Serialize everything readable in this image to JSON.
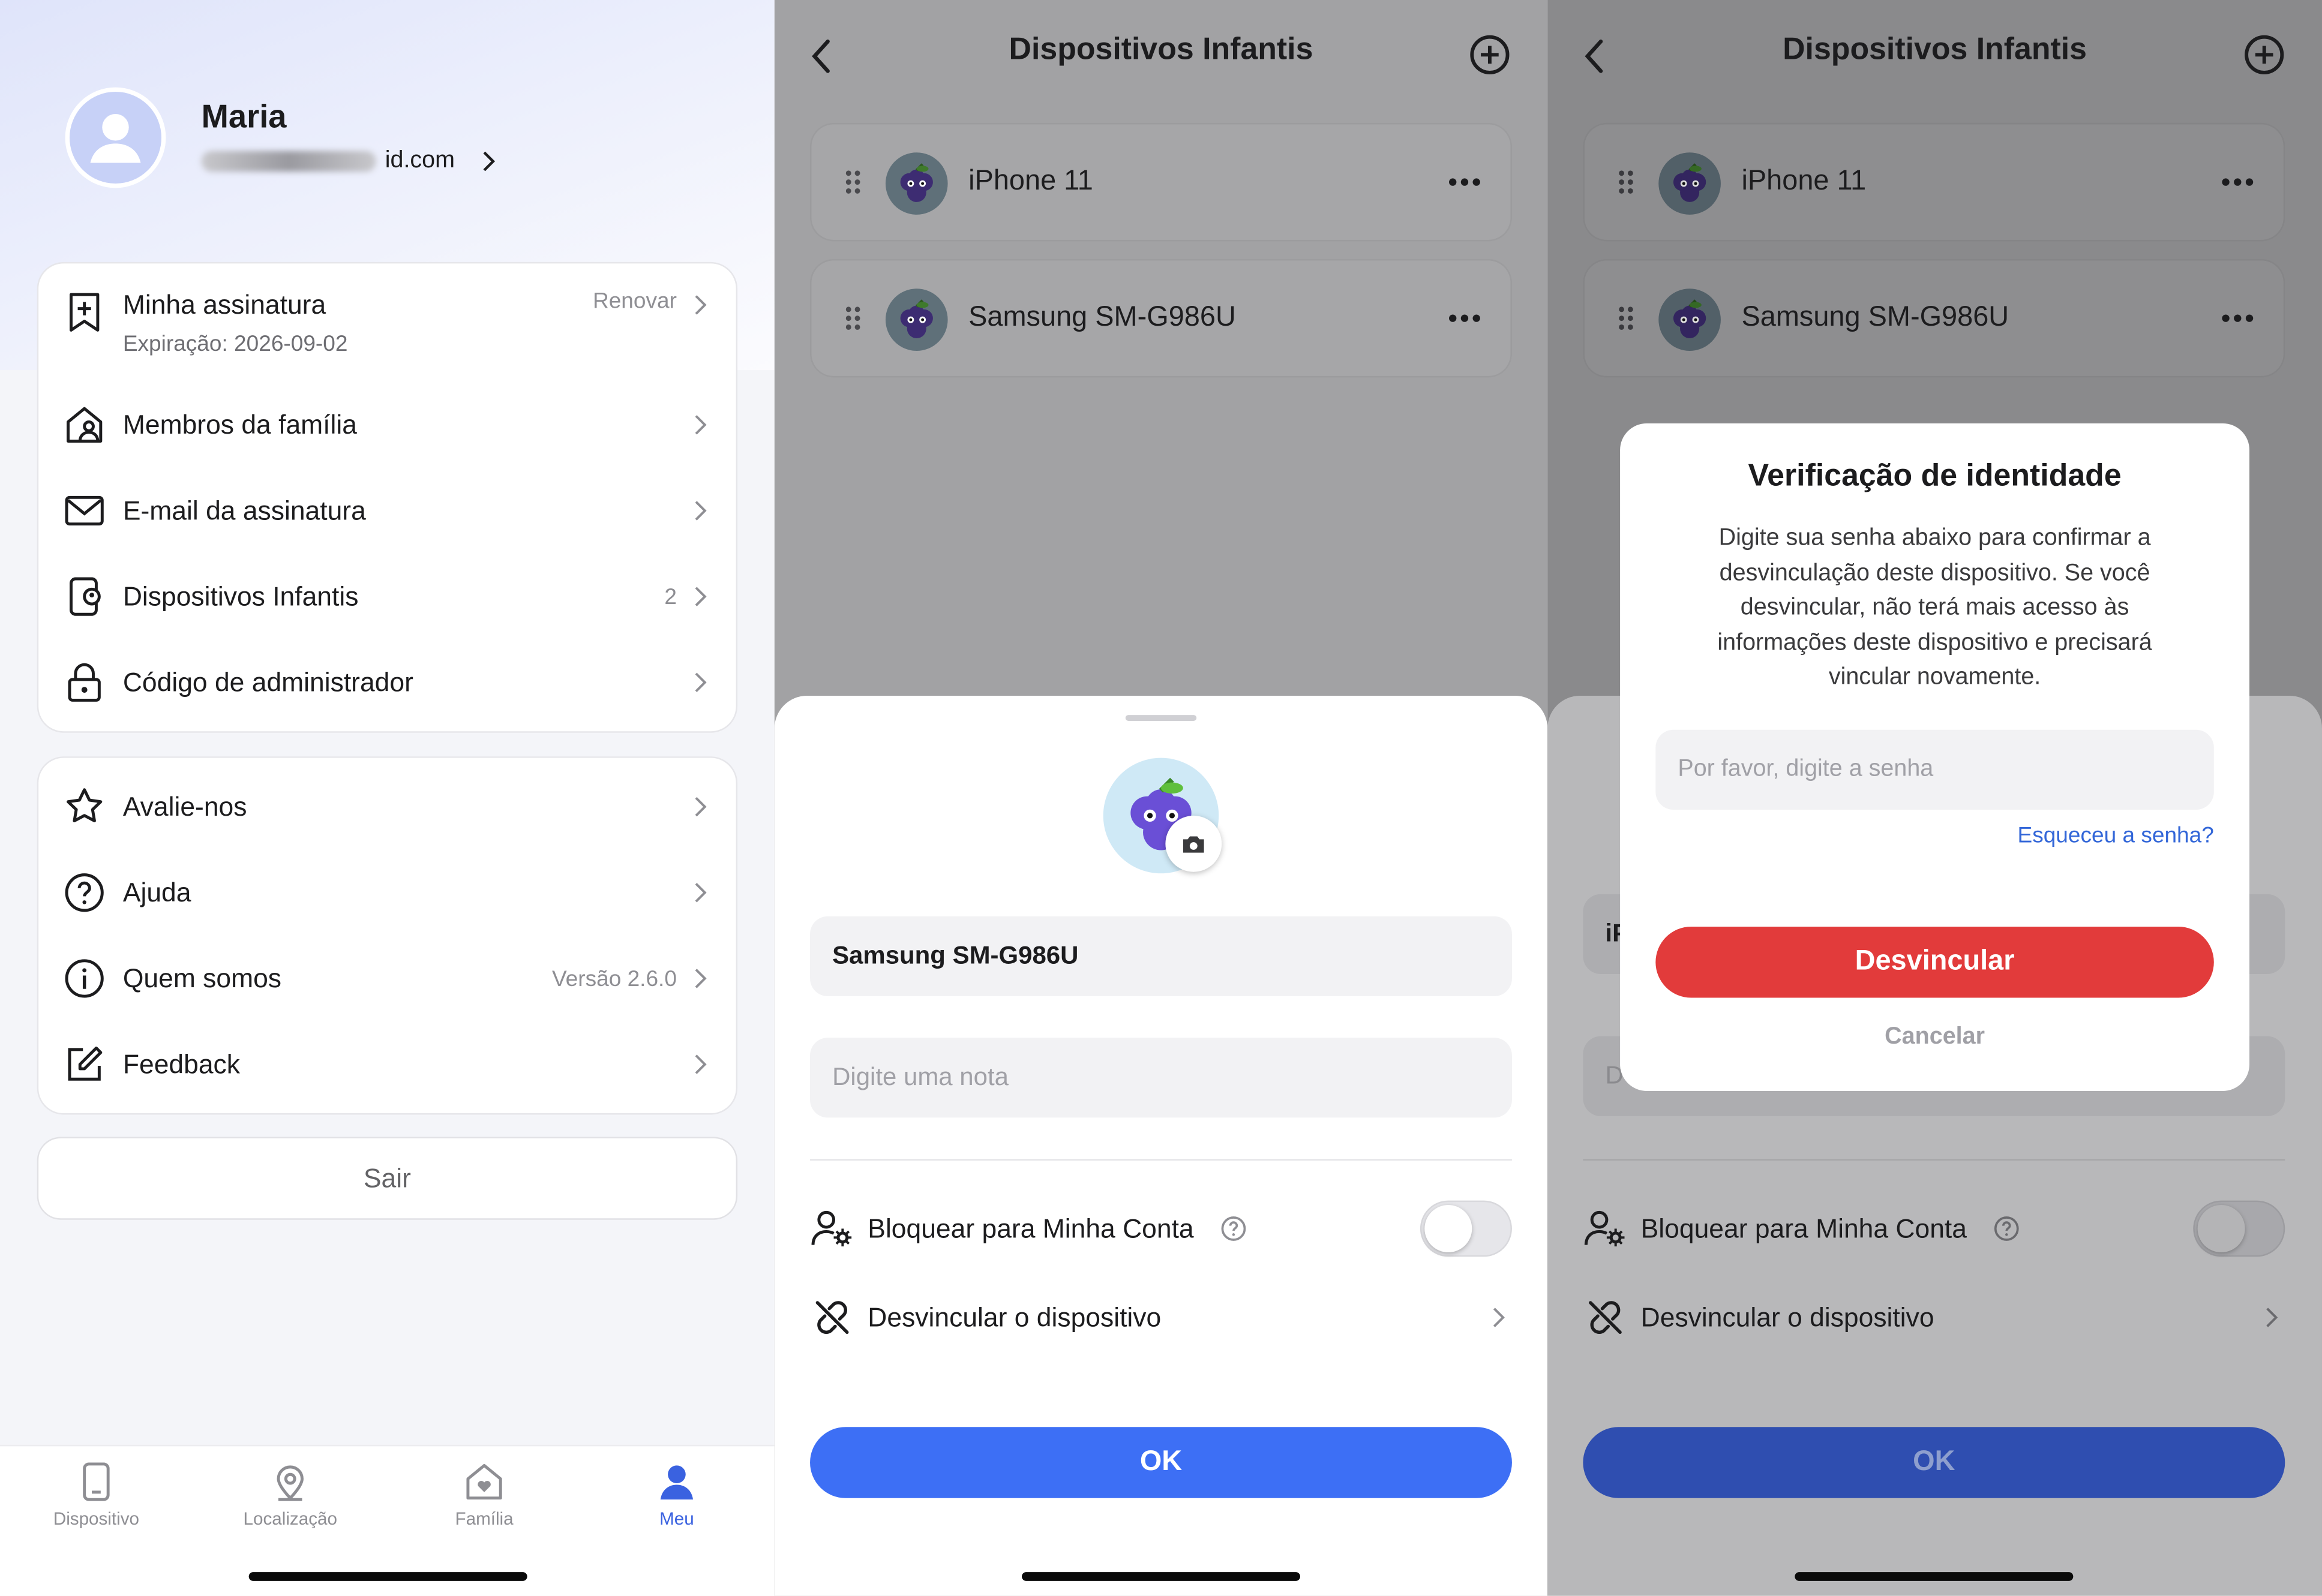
{
  "screen1": {
    "profile": {
      "name": "Maria",
      "email_suffix": "id.com"
    },
    "subscription": {
      "title": "Minha assinatura",
      "expiration": "Expiração: 2026-09-02",
      "renew_label": "Renovar"
    },
    "menu1": [
      {
        "label": "Membros da família",
        "value": "",
        "icon": "family-house-icon"
      },
      {
        "label": "E-mail da assinatura",
        "value": "",
        "icon": "mail-icon"
      },
      {
        "label": "Dispositivos Infantis",
        "value": "2",
        "icon": "child-device-icon"
      },
      {
        "label": "Código de administrador",
        "value": "",
        "icon": "lock-icon"
      }
    ],
    "menu2": [
      {
        "label": "Avalie-nos",
        "value": "",
        "icon": "star-icon"
      },
      {
        "label": "Ajuda",
        "value": "",
        "icon": "help-icon"
      },
      {
        "label": "Quem somos",
        "value": "Versão 2.6.0",
        "icon": "info-icon"
      },
      {
        "label": "Feedback",
        "value": "",
        "icon": "edit-icon"
      }
    ],
    "logout_label": "Sair",
    "tabs": [
      {
        "label": "Dispositivo",
        "icon": "phone-icon",
        "active": false
      },
      {
        "label": "Localização",
        "icon": "location-pin-icon",
        "active": false
      },
      {
        "label": "Família",
        "icon": "home-heart-icon",
        "active": false
      },
      {
        "label": "Meu",
        "icon": "person-icon",
        "active": true
      }
    ],
    "accent_color": "#3a62e0"
  },
  "screen2": {
    "title": "Dispositivos Infantis",
    "devices": [
      {
        "name": "iPhone 11"
      },
      {
        "name": "Samsung SM-G986U"
      }
    ],
    "sheet": {
      "device_name": "Samsung SM-G986U",
      "note_placeholder": "Digite uma nota",
      "lock_label": "Bloquear para Minha Conta",
      "lock_enabled": false,
      "unlink_label": "Desvincular o dispositivo",
      "ok_label": "OK"
    }
  },
  "screen3": {
    "title": "Dispositivos Infantis",
    "devices": [
      {
        "name": "iPhone 11"
      },
      {
        "name": "Samsung SM-G986U"
      }
    ],
    "sheet": {
      "partial_device": "iP",
      "partial_note": "D",
      "lock_label": "Bloquear para Minha Conta",
      "unlink_label": "Desvincular o dispositivo",
      "ok_label": "OK"
    },
    "dialog": {
      "title": "Verificação de identidade",
      "message": "Digite sua senha abaixo para confirmar a desvinculação deste dispositivo. Se você desvincular, não terá mais acesso às informações deste dispositivo e precisará vincular novamente.",
      "password_placeholder": "Por favor, digite a senha",
      "forgot_label": "Esqueceu a senha?",
      "confirm_label": "Desvincular",
      "cancel_label": "Cancelar",
      "danger_color": "#e23b3b"
    }
  }
}
